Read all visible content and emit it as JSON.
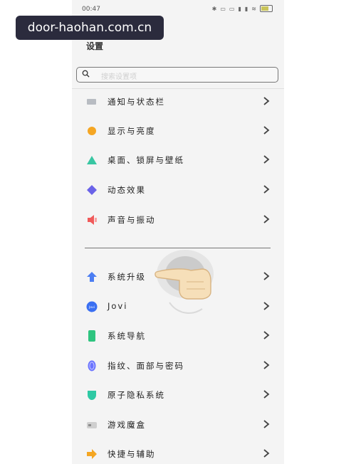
{
  "watermark": "door-haohan.com.cn",
  "status": {
    "time": "00:47",
    "icons": [
      "bluetooth-icon",
      "nfc-icon",
      "hd-icon",
      "4g-icon",
      "5g-icon",
      "wifi-icon",
      "battery-icon"
    ]
  },
  "header": {
    "title": "设置"
  },
  "search": {
    "placeholder": "搜索设置项"
  },
  "items": [
    {
      "label": "通知与状态栏",
      "icon": "notification-icon",
      "color": "#9aa0a6"
    },
    {
      "label": "显示与亮度",
      "icon": "brightness-icon",
      "color": "#f5a623"
    },
    {
      "label": "桌面、锁屏与壁纸",
      "icon": "wallpaper-icon",
      "color": "#38c6a2"
    },
    {
      "label": "动态效果",
      "icon": "animation-icon",
      "color": "#6a63e8"
    },
    {
      "label": "声音与振动",
      "icon": "sound-icon",
      "color": "#f05a5a"
    },
    {
      "label": "系统升级",
      "icon": "upgrade-icon",
      "color": "#4b7df2"
    },
    {
      "label": "Jovi",
      "icon": "jovi-icon",
      "color": "#3a6ff2"
    },
    {
      "label": "系统导航",
      "icon": "navigation-icon",
      "color": "#2ec47f"
    },
    {
      "label": "指纹、面部与密码",
      "icon": "fingerprint-icon",
      "color": "#6b74ff"
    },
    {
      "label": "原子隐私系统",
      "icon": "privacy-icon",
      "color": "#2ec9a4"
    },
    {
      "label": "游戏魔盒",
      "icon": "game-icon",
      "color": "#8c8c8c"
    },
    {
      "label": "快捷与辅助",
      "icon": "shortcut-icon",
      "color": "#f4a623"
    }
  ]
}
